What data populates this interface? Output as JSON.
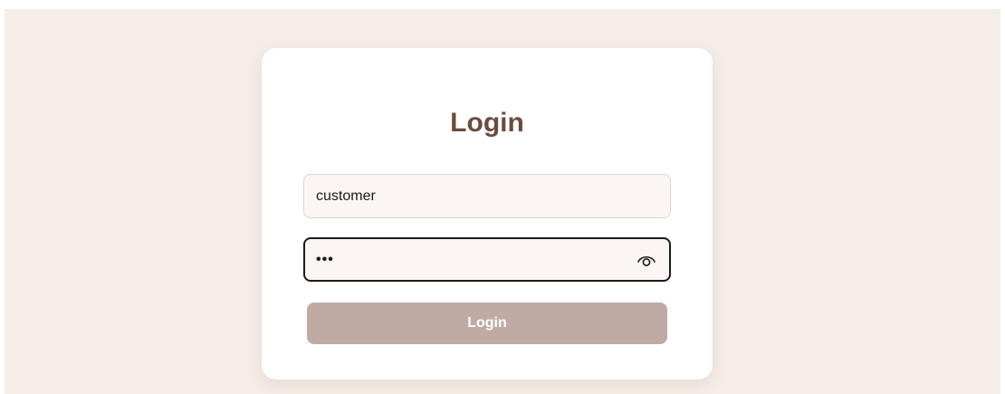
{
  "login_form": {
    "title": "Login",
    "username": {
      "value": "customer",
      "placeholder": ""
    },
    "password": {
      "value": "abc",
      "placeholder": "",
      "toggle_icon": "eye-icon"
    },
    "submit_label": "Login"
  },
  "colors": {
    "page_background": "#f5ede7",
    "title": "#6b4c3f",
    "button_background": "#bfaba4",
    "button_text": "#ffffff"
  }
}
